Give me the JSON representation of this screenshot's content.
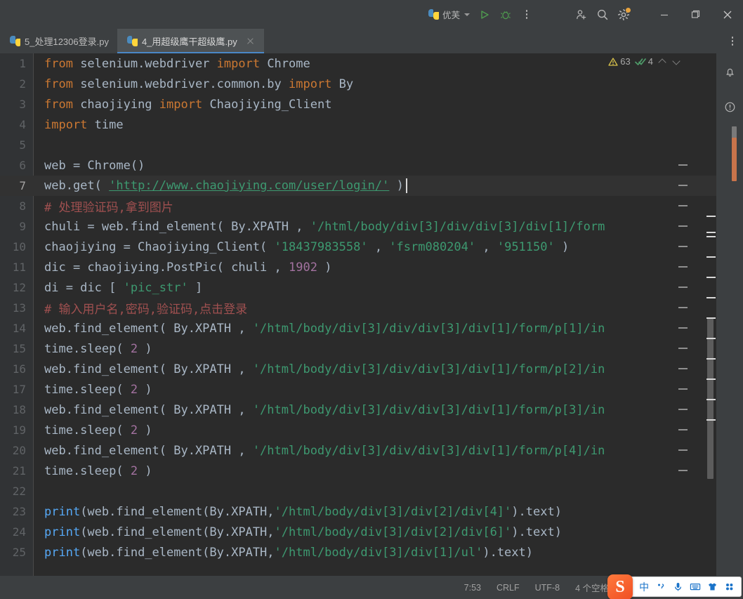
{
  "titlebar": {
    "run_config": {
      "label": "优芙",
      "icon": "python-icon",
      "chevron": "chevron-down-icon"
    },
    "run_button": "run-icon",
    "debug_button": "debug-icon",
    "more_button": "more-vertical-icon",
    "share_button": "add-user-icon",
    "search_button": "search-icon",
    "settings_button": "gear-icon",
    "minimize_button": "minimize-icon",
    "maximize_button": "maximize-icon",
    "close_button": "close-icon"
  },
  "tabs": [
    {
      "label": "5_处理12306登录.py",
      "active": false,
      "closable": false
    },
    {
      "label": "4_用超级鹰干超级鹰.py",
      "active": true,
      "closable": true
    }
  ],
  "tab_overflow": "more-options-icon",
  "inspections": {
    "warning_count": "63",
    "warning_icon": "warning-triangle-icon",
    "ok_count": "4",
    "ok_icon": "checkmark-icon",
    "prev_icon": "chevron-up-icon",
    "next_icon": "chevron-down-icon"
  },
  "right_stripe": {
    "notifications_icon": "bell-icon",
    "problems_icon": "exclamation-circle-icon"
  },
  "editor": {
    "language": "python",
    "caret_line": 7,
    "lines": [
      {
        "n": "1",
        "tokens": [
          {
            "t": "from",
            "c": "k"
          },
          {
            "t": " selenium.webdriver ",
            "c": "f"
          },
          {
            "t": "import",
            "c": "k"
          },
          {
            "t": " Chrome",
            "c": "f"
          }
        ]
      },
      {
        "n": "2",
        "tokens": [
          {
            "t": "from",
            "c": "k"
          },
          {
            "t": " selenium.webdriver.common.by ",
            "c": "f"
          },
          {
            "t": "import",
            "c": "k"
          },
          {
            "t": " By",
            "c": "f"
          }
        ]
      },
      {
        "n": "3",
        "tokens": [
          {
            "t": "from",
            "c": "k"
          },
          {
            "t": " chaojiying ",
            "c": "f"
          },
          {
            "t": "import",
            "c": "k"
          },
          {
            "t": " Chaojiying_Client",
            "c": "f"
          }
        ]
      },
      {
        "n": "4",
        "tokens": [
          {
            "t": "import",
            "c": "k"
          },
          {
            "t": " time",
            "c": "f"
          }
        ]
      },
      {
        "n": "5",
        "tokens": []
      },
      {
        "n": "6",
        "tokens": [
          {
            "t": "web = Chrome()",
            "c": "f"
          }
        ]
      },
      {
        "n": "7",
        "tokens": [
          {
            "t": "web.get",
            "c": "f"
          },
          {
            "t": "(",
            "c": "f"
          },
          {
            "t": " ",
            "c": "f"
          },
          {
            "t": "'http://www.chaojiying.com/user/login/'",
            "c": "url"
          },
          {
            "t": " )",
            "c": "f"
          }
        ],
        "current": true
      },
      {
        "n": "8",
        "tokens": [
          {
            "t": "# 处理验证码,拿到图片",
            "c": "c"
          }
        ]
      },
      {
        "n": "9",
        "tokens": [
          {
            "t": "chuli = web.find_element( By.XPATH , ",
            "c": "f"
          },
          {
            "t": "'/html/body/div[3]/div/div[3]/div[1]/form",
            "c": "s2"
          }
        ]
      },
      {
        "n": "10",
        "tokens": [
          {
            "t": "chaojiying = Chaojiying_Client( ",
            "c": "f"
          },
          {
            "t": "'18437983558'",
            "c": "s2"
          },
          {
            "t": " , ",
            "c": "f"
          },
          {
            "t": "'fsrm080204'",
            "c": "s2"
          },
          {
            "t": " , ",
            "c": "f"
          },
          {
            "t": "'951150'",
            "c": "s2"
          },
          {
            "t": " )",
            "c": "f"
          }
        ]
      },
      {
        "n": "11",
        "tokens": [
          {
            "t": "dic = chaojiying.PostPic( chuli , ",
            "c": "f"
          },
          {
            "t": "1902",
            "c": "n"
          },
          {
            "t": " )",
            "c": "f"
          }
        ]
      },
      {
        "n": "12",
        "tokens": [
          {
            "t": "di = dic [ ",
            "c": "f"
          },
          {
            "t": "'pic_str'",
            "c": "s2"
          },
          {
            "t": " ]",
            "c": "f"
          }
        ]
      },
      {
        "n": "13",
        "tokens": [
          {
            "t": "# 输入用户名,密码,验证码,点击登录",
            "c": "c"
          }
        ]
      },
      {
        "n": "14",
        "tokens": [
          {
            "t": "web.find_element( By.XPATH , ",
            "c": "f"
          },
          {
            "t": "'/html/body/div[3]/div/div[3]/div[1]/form/p[1]/in",
            "c": "s2"
          }
        ]
      },
      {
        "n": "15",
        "tokens": [
          {
            "t": "time.sleep( ",
            "c": "f"
          },
          {
            "t": "2",
            "c": "n"
          },
          {
            "t": " )",
            "c": "f"
          }
        ]
      },
      {
        "n": "16",
        "tokens": [
          {
            "t": "web.find_element( By.XPATH , ",
            "c": "f"
          },
          {
            "t": "'/html/body/div[3]/div/div[3]/div[1]/form/p[2]/in",
            "c": "s2"
          }
        ]
      },
      {
        "n": "17",
        "tokens": [
          {
            "t": "time.sleep( ",
            "c": "f"
          },
          {
            "t": "2",
            "c": "n"
          },
          {
            "t": " )",
            "c": "f"
          }
        ]
      },
      {
        "n": "18",
        "tokens": [
          {
            "t": "web.find_element( By.XPATH , ",
            "c": "f"
          },
          {
            "t": "'/html/body/div[3]/div/div[3]/div[1]/form/p[3]/in",
            "c": "s2"
          }
        ]
      },
      {
        "n": "19",
        "tokens": [
          {
            "t": "time.sleep( ",
            "c": "f"
          },
          {
            "t": "2",
            "c": "n"
          },
          {
            "t": " )",
            "c": "f"
          }
        ]
      },
      {
        "n": "20",
        "tokens": [
          {
            "t": "web.find_element( By.XPATH , ",
            "c": "f"
          },
          {
            "t": "'/html/body/div[3]/div/div[3]/div[1]/form/p[4]/in",
            "c": "s2"
          }
        ]
      },
      {
        "n": "21",
        "tokens": [
          {
            "t": "time.sleep( ",
            "c": "f"
          },
          {
            "t": "2",
            "c": "n"
          },
          {
            "t": " )",
            "c": "f"
          }
        ]
      },
      {
        "n": "22",
        "tokens": []
      },
      {
        "n": "23",
        "tokens": [
          {
            "t": "print",
            "c": "fn"
          },
          {
            "t": "(web.find_element(By.XPATH,",
            "c": "f"
          },
          {
            "t": "'/html/body/div[3]/div[2]/div[4]'",
            "c": "s2"
          },
          {
            "t": ").text)",
            "c": "f"
          }
        ]
      },
      {
        "n": "24",
        "tokens": [
          {
            "t": "print",
            "c": "fn"
          },
          {
            "t": "(web.find_element(By.XPATH,",
            "c": "f"
          },
          {
            "t": "'/html/body/div[3]/div[2]/div[6]'",
            "c": "s2"
          },
          {
            "t": ").text)",
            "c": "f"
          }
        ]
      },
      {
        "n": "25",
        "tokens": [
          {
            "t": "print",
            "c": "fn"
          },
          {
            "t": "(web.find_element(By.XPATH,",
            "c": "f"
          },
          {
            "t": "'/html/body/div[3]/div[1]/ul'",
            "c": "s2"
          },
          {
            "t": ").text)",
            "c": "f"
          }
        ]
      }
    ]
  },
  "statusbar": {
    "caret_position": "7:53",
    "line_separator": "CRLF",
    "encoding": "UTF-8",
    "indent": "4 个空格"
  },
  "ime": {
    "logo": "S",
    "mode_label": "中",
    "punctuation_icon": "punctuation-icon",
    "voice_icon": "microphone-icon",
    "keyboard_icon": "keyboard-icon",
    "skin_icon": "skin-icon",
    "toolbox_icon": "toolbox-icon"
  },
  "colors": {
    "editor_bg": "#2b2b2b",
    "chrome_bg": "#3c3f41",
    "gutter_bg": "#313335",
    "tab_active": "#4e5254",
    "accent": "#4a88c7",
    "string": "#3d9970",
    "keyword": "#cc7832",
    "comment": "#a05050",
    "number": "#a372a0",
    "error_stripe": "#c9744b"
  }
}
